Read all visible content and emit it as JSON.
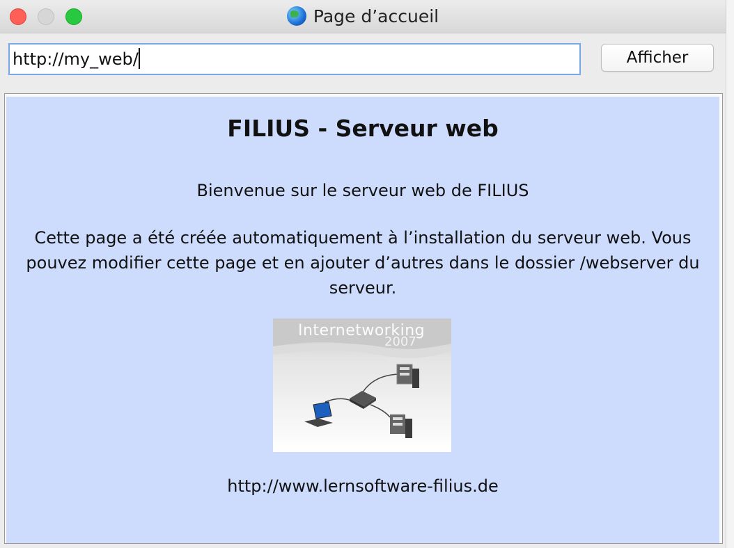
{
  "window": {
    "title": "Page d’accueil"
  },
  "toolbar": {
    "address_value": "http://my_web/",
    "show_button_label": "Afficher"
  },
  "page": {
    "heading": "FILIUS - Serveur web",
    "welcome": "Bienvenue sur le serveur web de FILIUS",
    "description": "Cette page a été créée automatiquement à l’installation du serveur web. Vous pouvez modifier cette page et en ajouter d’autres dans le dossier /webserver du serveur.",
    "logo": {
      "title": "Internetworking",
      "year": "2007"
    },
    "website": "http://www.lernsoftware-filius.de"
  }
}
